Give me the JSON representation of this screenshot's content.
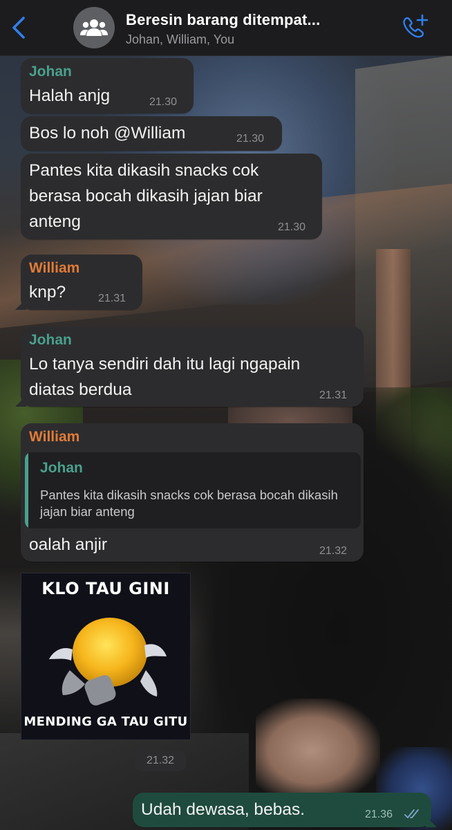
{
  "header": {
    "title": "Beresin barang ditempat...",
    "participants": "Johan, William, You",
    "back_icon": "chevron-left-icon",
    "avatar_icon": "group-icon",
    "call_icon": "add-call-icon"
  },
  "colors": {
    "johan": "#4aa08d",
    "william": "#e07b38",
    "incoming_bubble": "#2c2c2e",
    "outgoing_bubble": "#1f4b3e",
    "accent_blue": "#2f80ed"
  },
  "messages": [
    {
      "sender": "Johan",
      "lines": [
        "Halah anjg"
      ],
      "time": "21.30"
    },
    {
      "lines": [
        "Bos lo noh @William"
      ],
      "time": "21.30"
    },
    {
      "lines": [
        "Pantes kita dikasih snacks cok",
        "berasa bocah dikasih jajan biar",
        "anteng"
      ],
      "time": "21.30"
    },
    {
      "sender": "William",
      "lines": [
        "knp?"
      ],
      "time": "21.31"
    },
    {
      "sender": "Johan",
      "lines": [
        "Lo tanya sendiri dah itu lagi ngapain",
        "diatas berdua"
      ],
      "time": "21.31"
    },
    {
      "sender": "William",
      "quote": {
        "sender": "Johan",
        "text": "Pantes kita dikasih snacks cok berasa bocah dikasih jajan biar anteng"
      },
      "lines": [
        "oalah anjir"
      ],
      "time": "21.32"
    }
  ],
  "sticker": {
    "top_text": "KLO TAU GINI",
    "bottom_text": "MENDING GA TAU GITU",
    "time": "21.32"
  },
  "outgoing": {
    "text": "Udah dewasa, bebas.",
    "time": "21.36",
    "status_icon": "double-check-icon"
  }
}
